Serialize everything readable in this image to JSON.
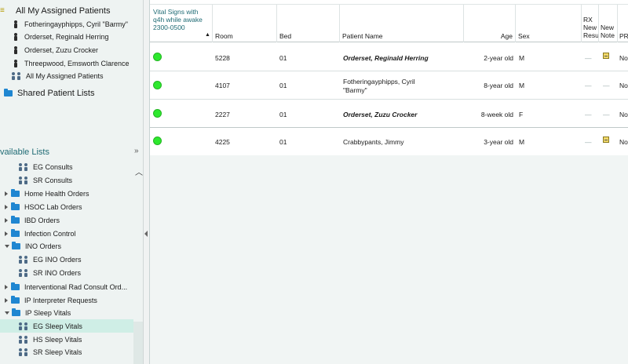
{
  "sidebar": {
    "my_patients_label": "All My Assigned Patients",
    "patients": [
      "Fotheringayphipps, Cyril \"Barmy\"",
      "Orderset, Reginald Herring",
      "Orderset, Zuzu Crocker",
      "Threepwood, Emsworth Clarence"
    ],
    "group_label": "All My Assigned Patients",
    "shared_lists_label": "Shared Patient Lists",
    "available_lists_label": "vailable Lists",
    "lists": [
      {
        "label": "EG Consults",
        "type": "group"
      },
      {
        "label": "SR Consults",
        "type": "group"
      },
      {
        "label": "Home Health Orders",
        "type": "folder"
      },
      {
        "label": "HSOC Lab Orders",
        "type": "folder"
      },
      {
        "label": "IBD Orders",
        "type": "folder"
      },
      {
        "label": "Infection Control",
        "type": "folder"
      },
      {
        "label": "INO Orders",
        "type": "folder-open"
      },
      {
        "label": "EG INO Orders",
        "type": "group"
      },
      {
        "label": "SR INO Orders",
        "type": "group"
      },
      {
        "label": "Interventional Rad Consult Ord...",
        "type": "folder"
      },
      {
        "label": "IP Interpreter Requests",
        "type": "folder"
      },
      {
        "label": "IP Sleep Vitals",
        "type": "folder-open"
      },
      {
        "label": "EG Sleep Vitals",
        "type": "group",
        "selected": true
      },
      {
        "label": "HS Sleep Vitals",
        "type": "group"
      },
      {
        "label": "SR Sleep Vitals",
        "type": "group"
      }
    ],
    "colors": {
      "selected_bg": "#cfeee6",
      "folder": "#1f86d1",
      "accent_text": "#1f6b74"
    }
  },
  "table": {
    "headers": {
      "vitals": "Vital Signs with q4h while awake 2300-0500",
      "room": "Room",
      "bed": "Bed",
      "patient_name": "Patient Name",
      "age": "Age",
      "sex": "Sex",
      "rx_new_result": "RX New Resu",
      "new_note": "New Note",
      "pr": "PR"
    },
    "rows": [
      {
        "status": "green",
        "room": "5228",
        "bed": "01",
        "name": "Orderset, Reginald Herring",
        "name_style": "bold-italic",
        "age": "2-year old",
        "sex": "M",
        "rx": "—",
        "note_icon": true,
        "pr": "No"
      },
      {
        "status": "green",
        "room": "4107",
        "bed": "01",
        "name": "Fotheringayphipps, Cyril \"Barmy\"",
        "name_style": "normal",
        "age": "8-year old",
        "sex": "M",
        "rx": "—",
        "note": "—",
        "pr": "No"
      },
      {
        "status": "green",
        "room": "2227",
        "bed": "01",
        "name": "Orderset, Zuzu Crocker",
        "name_style": "bold-italic",
        "age": "8-week old",
        "sex": "F",
        "rx": "—",
        "note": "—",
        "pr": "No"
      },
      {
        "status": "green",
        "room": "4225",
        "bed": "01",
        "name": "Crabbypants, Jimmy",
        "name_style": "normal",
        "age": "3-year old",
        "sex": "M",
        "rx": "—",
        "note_icon": true,
        "pr": "No"
      }
    ]
  }
}
